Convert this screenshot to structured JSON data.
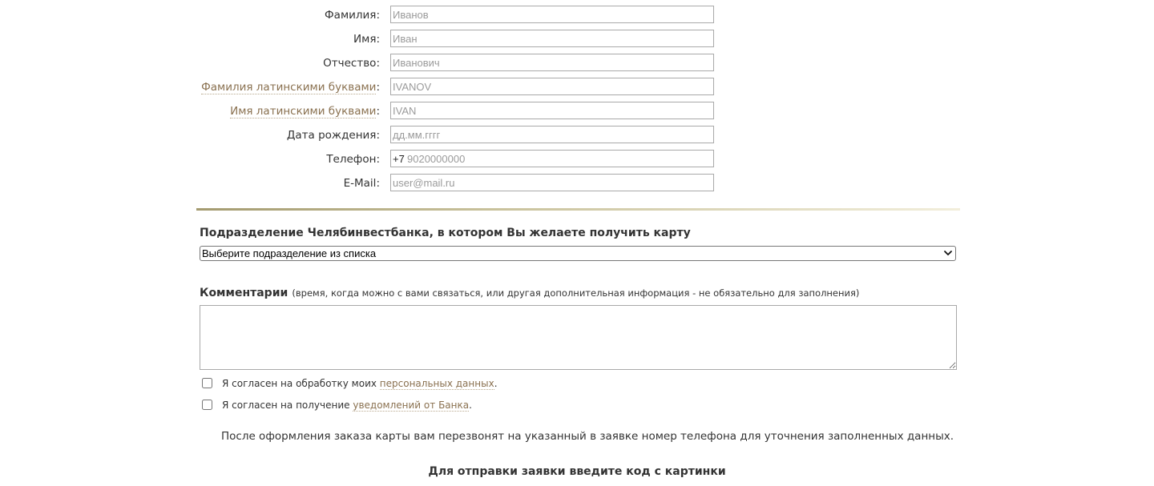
{
  "personal": {
    "fields": [
      {
        "label": "Фамилия",
        "placeholder": "Иванов"
      },
      {
        "label": "Имя",
        "placeholder": "Иван"
      },
      {
        "label": "Отчество",
        "placeholder": "Иванович"
      },
      {
        "label": "Фамилия латинскими буквами",
        "placeholder": "IVANOV"
      },
      {
        "label": "Имя латинскими буквами",
        "placeholder": "IVAN"
      },
      {
        "label": "Дата рождения",
        "placeholder": "дд.мм.гггг"
      },
      {
        "label": "Телефон",
        "prefix": "+7",
        "placeholder": "9020000000"
      },
      {
        "label": "E-Mail",
        "placeholder": "user@mail.ru"
      }
    ],
    "label_suffix": ":"
  },
  "branch": {
    "title": "Подразделение Челябинвестбанка, в котором Вы желаете получить карту",
    "selected": "Выберите подразделение из списка"
  },
  "comment": {
    "title": "Комментарии",
    "note": "(время, когда можно с вами связаться, или другая дополнительная информация - не обязательно для заполнения)"
  },
  "consents": [
    {
      "text": "Я согласен на обработку моих ",
      "link": "персональных данных",
      "end": "."
    },
    {
      "text": "Я согласен на получение ",
      "link": "уведомлений от Банка",
      "end": "."
    }
  ],
  "callback_note": "После оформления заказа карты вам перезвонят на указанный в заявке номер телефона для уточнения заполненных данных.",
  "captcha_title": "Для отправки заявки введите код с картинки",
  "colors": {
    "link": "#8a7150",
    "divider_start": "#a39a6f"
  }
}
